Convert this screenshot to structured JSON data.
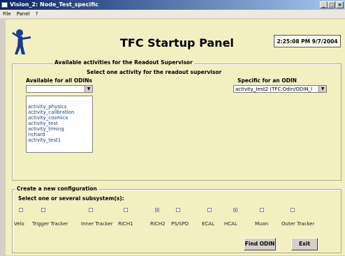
{
  "window": {
    "title": "Vision_2: Node_Test_specific"
  },
  "menu": [
    "File",
    "Panel",
    "?"
  ],
  "header": {
    "title": "TFC Startup Panel",
    "clock": "2:25:08 PM 9/7/2004"
  },
  "readout": {
    "frame_title": "Available activities for the Readout Supervisor",
    "instruction": "Select one activity for the readout supervisor",
    "all_label": "Available for all ODINs",
    "all_value": "",
    "all_options": [
      "activity_physics",
      "activity_calibration",
      "activity_cosmics",
      "activity_test",
      "activity_timing",
      "richard",
      "activity_test1"
    ],
    "specific_label": "Specific for an ODIN",
    "specific_value": "activity_test2 (TFC:Odin/ODIN_l"
  },
  "config": {
    "frame_title": "Create a new configuration",
    "instruction": "Select one or several subsystem(s):",
    "subsystems": [
      {
        "label": "Velo",
        "checked": false
      },
      {
        "label": "Trigger Tracker",
        "checked": false
      },
      {
        "label": "Inner Tracker",
        "checked": false
      },
      {
        "label": "RICH1",
        "checked": false
      },
      {
        "label": "RICH2",
        "checked": true
      },
      {
        "label": "PS/SPD",
        "checked": false
      },
      {
        "label": "ECAL",
        "checked": false
      },
      {
        "label": "HCAL",
        "checked": true
      },
      {
        "label": "Muon",
        "checked": false
      },
      {
        "label": "Outer Tracker",
        "checked": false
      }
    ],
    "find_button": "Find ODIN",
    "exit_button": "Exit"
  }
}
